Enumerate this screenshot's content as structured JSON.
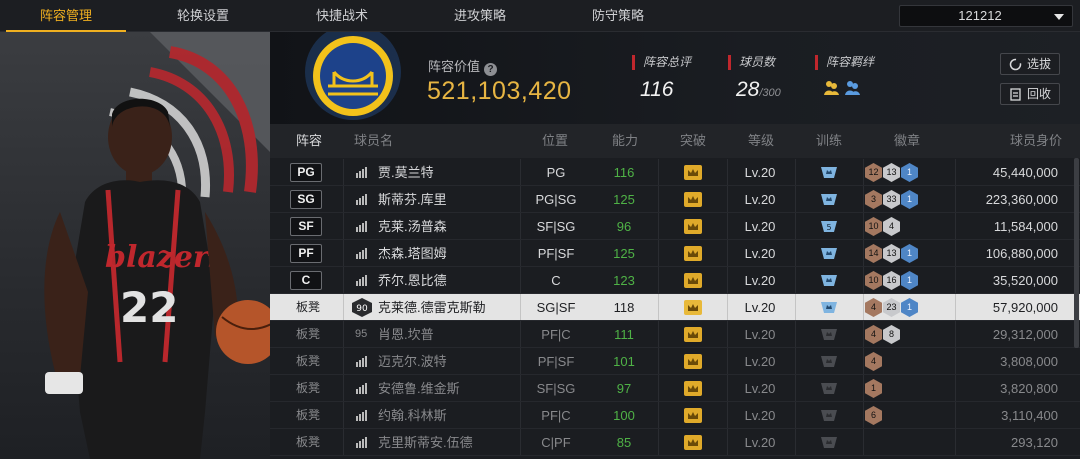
{
  "tabs": [
    "阵容管理",
    "轮换设置",
    "快捷战术",
    "进攻策略",
    "防守策略"
  ],
  "team_select": {
    "value": "121212"
  },
  "header": {
    "value_label": "阵容价值",
    "value": "521,103,420",
    "total_rating_label": "阵容总评",
    "total_rating": "116",
    "player_count_label": "球员数",
    "player_count": "28",
    "player_count_max": "/300",
    "bonds_label": "阵容羁绊",
    "select_button": "选拔",
    "recycle_button": "回收"
  },
  "columns": [
    "阵容",
    "球员名",
    "位置",
    "能力",
    "突破",
    "等级",
    "训练",
    "徽章",
    "球员身价"
  ],
  "colors": {
    "accent": "#f0b020",
    "value": "#e7b543",
    "ability_green": "#4fb246",
    "stat_marker": "#c0272d"
  },
  "rows": [
    {
      "slot": "PG",
      "name": "贾.莫兰特",
      "position": "PG",
      "ability": "116",
      "level": "Lv.20",
      "badges": [
        [
          "bronze",
          "12"
        ],
        [
          "silver",
          "13"
        ],
        [
          "blue",
          "1"
        ]
      ],
      "price": "45,440,000"
    },
    {
      "slot": "SG",
      "name": "斯蒂芬.库里",
      "position": "PG|SG",
      "ability": "125",
      "level": "Lv.20",
      "badges": [
        [
          "bronze",
          "3"
        ],
        [
          "silver",
          "33"
        ],
        [
          "blue",
          "1"
        ]
      ],
      "price": "223,360,000"
    },
    {
      "slot": "SF",
      "name": "克莱.汤普森",
      "position": "SF|SG",
      "ability": "96",
      "level": "Lv.20",
      "train": "5",
      "badges": [
        [
          "bronze",
          "10"
        ],
        [
          "silver",
          "4"
        ]
      ],
      "price": "11,584,000"
    },
    {
      "slot": "PF",
      "name": "杰森.塔图姆",
      "position": "PF|SF",
      "ability": "125",
      "level": "Lv.20",
      "badges": [
        [
          "bronze",
          "14"
        ],
        [
          "silver",
          "13"
        ],
        [
          "blue",
          "1"
        ]
      ],
      "price": "106,880,000"
    },
    {
      "slot": "C",
      "name": "乔尔.恩比德",
      "position": "C",
      "ability": "123",
      "level": "Lv.20",
      "badges": [
        [
          "bronze",
          "10"
        ],
        [
          "silver",
          "16"
        ],
        [
          "blue",
          "1"
        ]
      ],
      "price": "35,520,000"
    },
    {
      "slot": "板凳",
      "grade": "90",
      "name": "克莱德.德雷克斯勒",
      "position": "SG|SF",
      "ability": "118",
      "level": "Lv.20",
      "badges": [
        [
          "bronze",
          "4"
        ],
        [
          "silver",
          "23"
        ],
        [
          "blue",
          "1"
        ]
      ],
      "price": "57,920,000"
    },
    {
      "slot": "板凳",
      "grade": "95",
      "name": "肖恩.坎普",
      "position": "PF|C",
      "ability": "111",
      "level": "Lv.20",
      "badges": [
        [
          "bronze",
          "4"
        ],
        [
          "silver",
          "8"
        ]
      ],
      "price": "29,312,000"
    },
    {
      "slot": "板凳",
      "name": "迈克尔.波特",
      "position": "PF|SF",
      "ability": "101",
      "level": "Lv.20",
      "badges": [
        [
          "bronze",
          "4"
        ]
      ],
      "price": "3,808,000"
    },
    {
      "slot": "板凳",
      "name": "安德鲁.维金斯",
      "position": "SF|SG",
      "ability": "97",
      "level": "Lv.20",
      "badges": [
        [
          "bronze",
          "1"
        ]
      ],
      "price": "3,820,800"
    },
    {
      "slot": "板凳",
      "name": "约翰.科林斯",
      "position": "PF|C",
      "ability": "100",
      "level": "Lv.20",
      "badges": [
        [
          "bronze",
          "6"
        ]
      ],
      "price": "3,110,400"
    },
    {
      "slot": "板凳",
      "name": "克里斯蒂安.伍德",
      "position": "C|PF",
      "ability": "85",
      "level": "Lv.20",
      "badges": [],
      "price": "293,120"
    }
  ]
}
